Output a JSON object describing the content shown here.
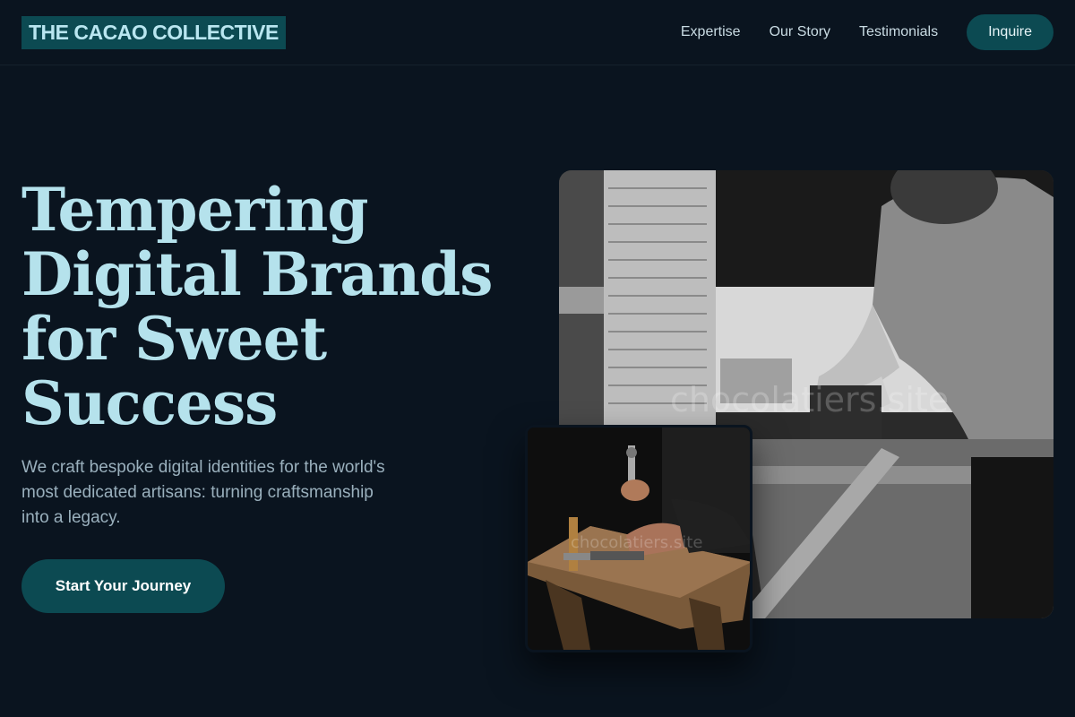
{
  "header": {
    "logo": "THE CACAO COLLECTIVE",
    "nav": [
      "Expertise",
      "Our Story",
      "Testimonials"
    ],
    "cta": "Inquire"
  },
  "hero": {
    "title": "Tempering Digital Brands for Sweet Success",
    "subtitle": "We craft bespoke digital identities for the world's most dedicated artisans: turning craftsmanship into a legacy.",
    "cta": "Start Your Journey"
  },
  "images": {
    "large_watermark": "chocolatiers.site",
    "small_watermark": "chocolatiers.site"
  },
  "colors": {
    "background": "#0a141f",
    "accent": "#0c4a52",
    "heading": "#b5e2ec",
    "body_text": "#9ab0bd"
  }
}
